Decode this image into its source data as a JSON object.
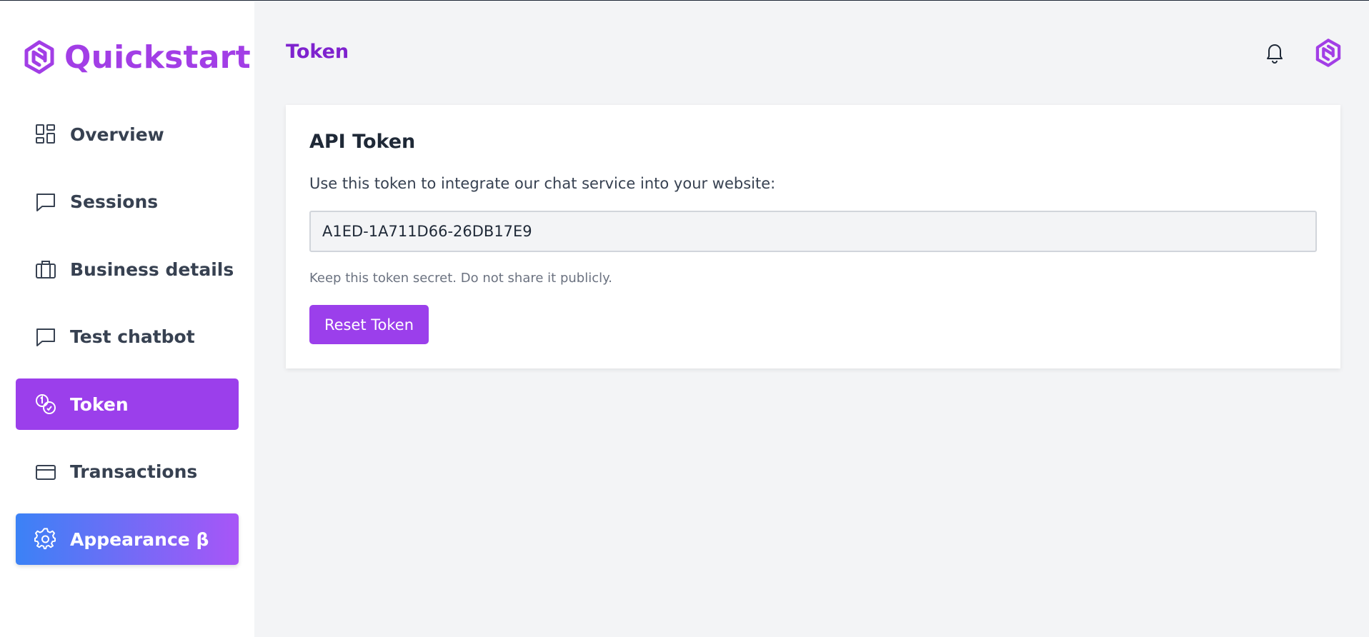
{
  "app": {
    "name": "Quickstart",
    "brand_color": "#a23ee6"
  },
  "sidebar": {
    "items": [
      {
        "label": "Overview",
        "icon": "grid-icon",
        "state": "default"
      },
      {
        "label": "Sessions",
        "icon": "chat-bubble-icon",
        "state": "default"
      },
      {
        "label": "Business details",
        "icon": "briefcase-icon",
        "state": "default"
      },
      {
        "label": "Test chatbot",
        "icon": "chat-bubble-icon",
        "state": "default"
      },
      {
        "label": "Token",
        "icon": "coins-icon",
        "state": "active"
      },
      {
        "label": "Transactions",
        "icon": "credit-card-icon",
        "state": "default"
      },
      {
        "label": "Appearance β",
        "icon": "gear-icon",
        "state": "highlighted"
      }
    ],
    "active_color": "#9b3feb"
  },
  "header": {
    "title": "Token",
    "icons": [
      "bell-icon",
      "avatar-logo-icon"
    ]
  },
  "card": {
    "title": "API Token",
    "description": "Use this token to integrate our chat service into your website:",
    "token_value": "A1ED-1A711D66-26DB17E9",
    "note": "Keep this token secret. Do not share it publicly.",
    "reset_label": "Reset Token"
  }
}
